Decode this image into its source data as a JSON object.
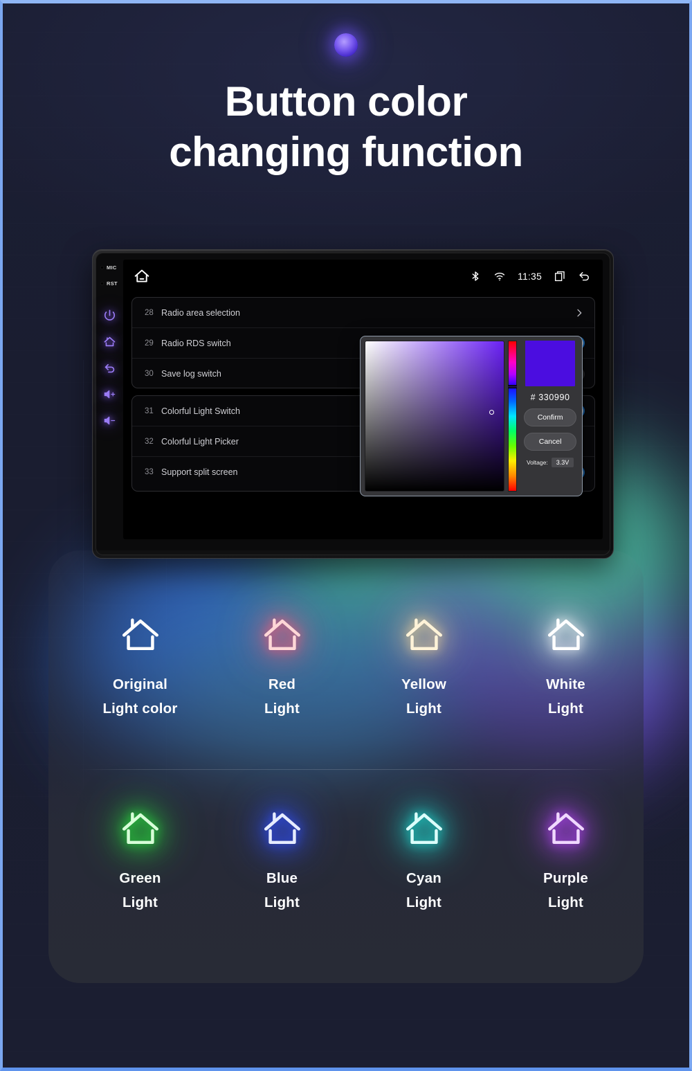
{
  "header": {
    "title_line1": "Button color",
    "title_line2": "changing function"
  },
  "device": {
    "bezel": {
      "mic_label": "MIC",
      "rst_label": "RST",
      "buttons": [
        {
          "name": "power-icon"
        },
        {
          "name": "home-icon"
        },
        {
          "name": "back-icon"
        },
        {
          "name": "volume-up-icon"
        },
        {
          "name": "volume-down-icon"
        }
      ]
    },
    "statusbar": {
      "home_icon": "home-icon",
      "bluetooth_icon": "bluetooth-icon",
      "wifi_icon": "wifi-icon",
      "time": "11:35",
      "recents_icon": "recent-apps-icon",
      "back_icon": "back-arrow-icon"
    },
    "settings_group_a": [
      {
        "num": "28",
        "label": "Radio area selection",
        "control": "chevron"
      },
      {
        "num": "29",
        "label": "Radio RDS switch",
        "control": "toggle-on"
      },
      {
        "num": "30",
        "label": "Save log switch",
        "control": "toggle-off"
      }
    ],
    "settings_group_b": [
      {
        "num": "31",
        "label": "Colorful Light Switch",
        "control": "toggle-on"
      },
      {
        "num": "32",
        "label": "Colorful Light Picker",
        "control": "chevron"
      },
      {
        "num": "33",
        "label": "Support split screen",
        "control": "toggle-on"
      }
    ],
    "color_picker": {
      "hex_label": "# 330990",
      "hex_value": "#330990",
      "confirm_label": "Confirm",
      "cancel_label": "Cancel",
      "voltage_label": "Voltage:",
      "voltage_value": "3.3V",
      "selected_color": "#4b0de0",
      "hue_position_pct": 29
    }
  },
  "showcase": {
    "row1": [
      {
        "id": "original",
        "line1": "Original",
        "line2": "Light color",
        "color": "#ffffff",
        "glow": "rgba(255,255,255,0.0)"
      },
      {
        "id": "red",
        "line1": "Red",
        "line2": "Light",
        "color": "#ffd7d7",
        "glow": "rgba(255,90,120,0.85)"
      },
      {
        "id": "yellow",
        "line1": "Yellow",
        "line2": "Light",
        "color": "#fff3d8",
        "glow": "rgba(255,220,150,0.8)"
      },
      {
        "id": "white",
        "line1": "White",
        "line2": "Light",
        "color": "#ffffff",
        "glow": "rgba(255,255,255,0.85)"
      }
    ],
    "row2": [
      {
        "id": "green",
        "line1": "Green",
        "line2": "Light",
        "color": "#d8ffd8",
        "glow": "rgba(40,230,60,0.95)"
      },
      {
        "id": "blue",
        "line1": "Blue",
        "line2": "Light",
        "color": "#e6ecff",
        "glow": "rgba(50,80,255,0.95)"
      },
      {
        "id": "cyan",
        "line1": "Cyan",
        "line2": "Light",
        "color": "#dcfffb",
        "glow": "rgba(30,225,215,0.95)"
      },
      {
        "id": "purple",
        "line1": "Purple",
        "line2": "Light",
        "color": "#f0d8ff",
        "glow": "rgba(185,70,255,0.95)"
      }
    ]
  },
  "colors": {
    "page_border": "#7ba7f0",
    "background": "#1a1d31",
    "toggle_on": "#1565b0",
    "toggle_off": "#2a2a2c",
    "bezel_icon": "#9a7bf5"
  }
}
